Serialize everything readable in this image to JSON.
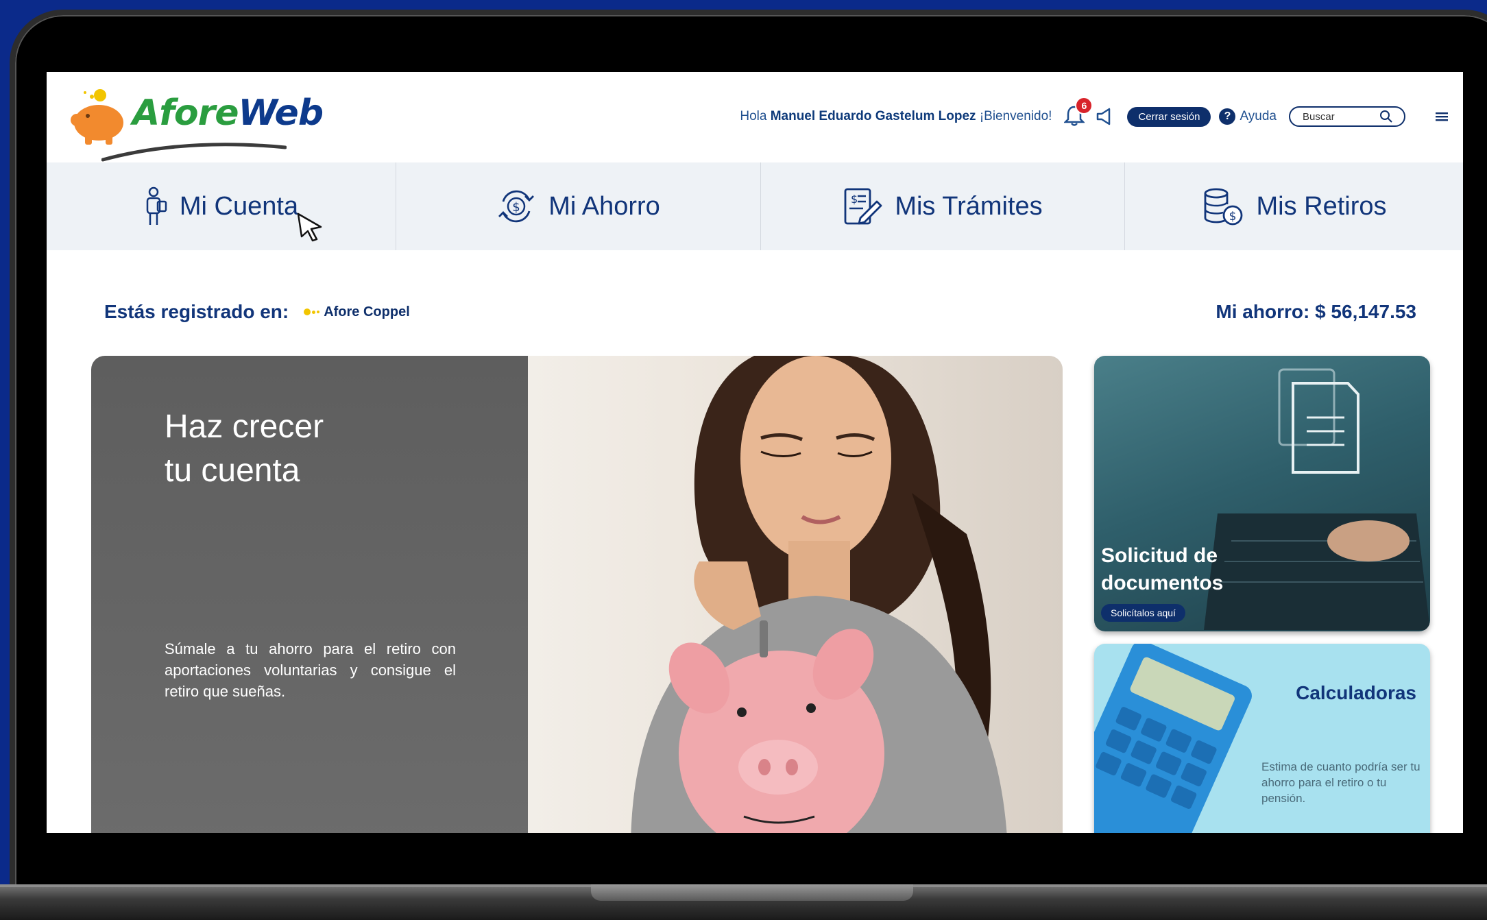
{
  "header": {
    "logo_text_a": "Afore",
    "logo_text_b": "Web",
    "greeting_prefix": "Hola",
    "user_name": "Manuel Eduardo Gastelum Lopez",
    "greeting_suffix": "¡Bienvenido!",
    "notification_count": "6",
    "logout_label": "Cerrar sesión",
    "help_label": "Ayuda",
    "search_placeholder": "Buscar"
  },
  "nav": {
    "items": [
      {
        "label": "Mi Cuenta",
        "icon": "user-icon"
      },
      {
        "label": "Mi Ahorro",
        "icon": "money-cycle-icon"
      },
      {
        "label": "Mis Trámites",
        "icon": "document-edit-icon"
      },
      {
        "label": "Mis Retiros",
        "icon": "coins-icon"
      }
    ]
  },
  "registration": {
    "label": "Estás registrado en:",
    "afore_name": "Afore Coppel",
    "savings_label": "Mi ahorro: $ 56,147.53"
  },
  "hero": {
    "title_line1": "Haz crecer",
    "title_line2": "tu cuenta",
    "description": "Súmale a tu ahorro para el retiro con aportaciones voluntarias y consigue el retiro que sueñas."
  },
  "cards": {
    "documents": {
      "title": "Solicitud de documentos",
      "button": "Solicítalos aquí"
    },
    "calculators": {
      "title": "Calculadoras",
      "description": "Estima de cuanto podría ser tu ahorro para el retiro o tu pensión."
    }
  },
  "colors": {
    "primary": "#11357a",
    "accent_green": "#2a9d3f",
    "badge_red": "#d8232a",
    "nav_bg": "#eef2f6"
  }
}
